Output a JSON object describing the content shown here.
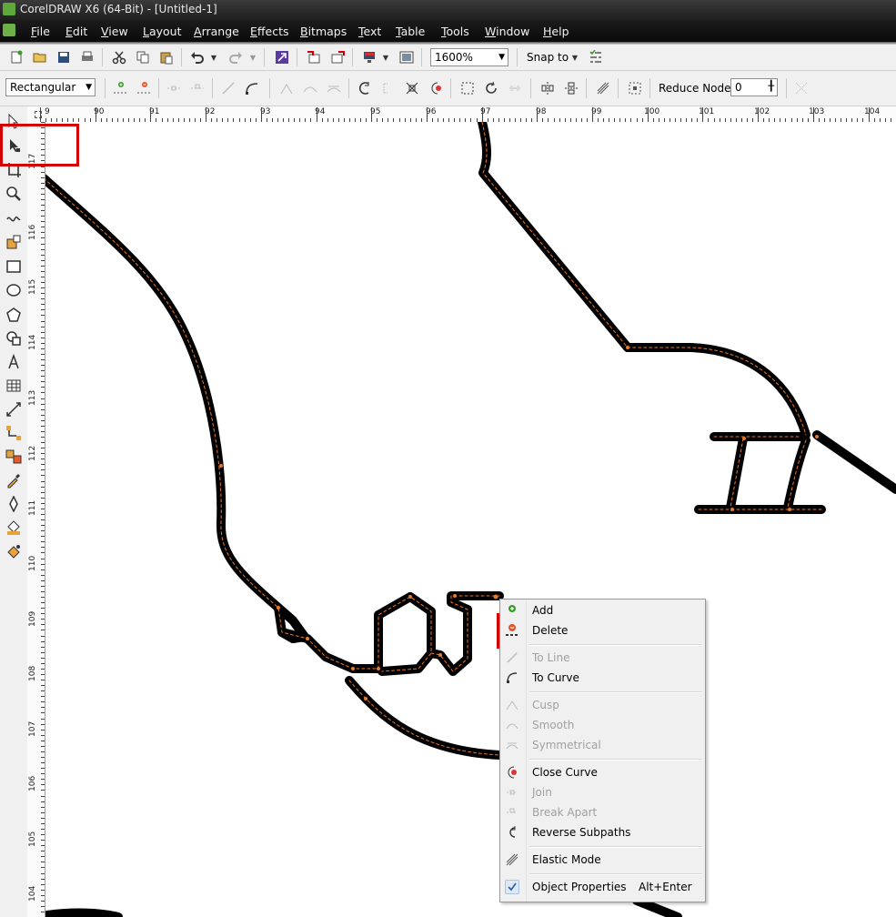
{
  "window": {
    "title": "CorelDRAW X6 (64-Bit) - [Untitled-1]"
  },
  "menu": [
    "File",
    "Edit",
    "View",
    "Layout",
    "Arrange",
    "Effects",
    "Bitmaps",
    "Text",
    "Table",
    "Tools",
    "Window",
    "Help"
  ],
  "toolbar": {
    "zoom_value": "1600%",
    "snap_label": "Snap to",
    "node_mode": "Rectangular",
    "reduce_nodes_label": "Reduce Nodes",
    "reduce_nodes_value": "0"
  },
  "ruler_h": [
    "9",
    "90",
    "91",
    "92",
    "93",
    "94",
    "95",
    "96",
    "97",
    "98",
    "99",
    "100",
    "101",
    "102",
    "103",
    "104"
  ],
  "ruler_v": [
    "117",
    "116",
    "115",
    "114",
    "113",
    "112",
    "111",
    "110",
    "109",
    "108",
    "107",
    "106",
    "105",
    "104"
  ],
  "context_menu": {
    "add": "Add",
    "delete": "Delete",
    "to_line": "To Line",
    "to_curve": "To Curve",
    "cusp": "Cusp",
    "smooth": "Smooth",
    "symmetrical": "Symmetrical",
    "close_curve": "Close Curve",
    "join": "Join",
    "break_apart": "Break Apart",
    "reverse_subpaths": "Reverse Subpaths",
    "elastic_mode": "Elastic Mode",
    "object_properties": "Object Properties",
    "object_properties_shortcut": "Alt+Enter"
  },
  "colors": {
    "highlight_box": "#d40000",
    "stroke": "#000000",
    "node_dash": "#e87a2a"
  }
}
